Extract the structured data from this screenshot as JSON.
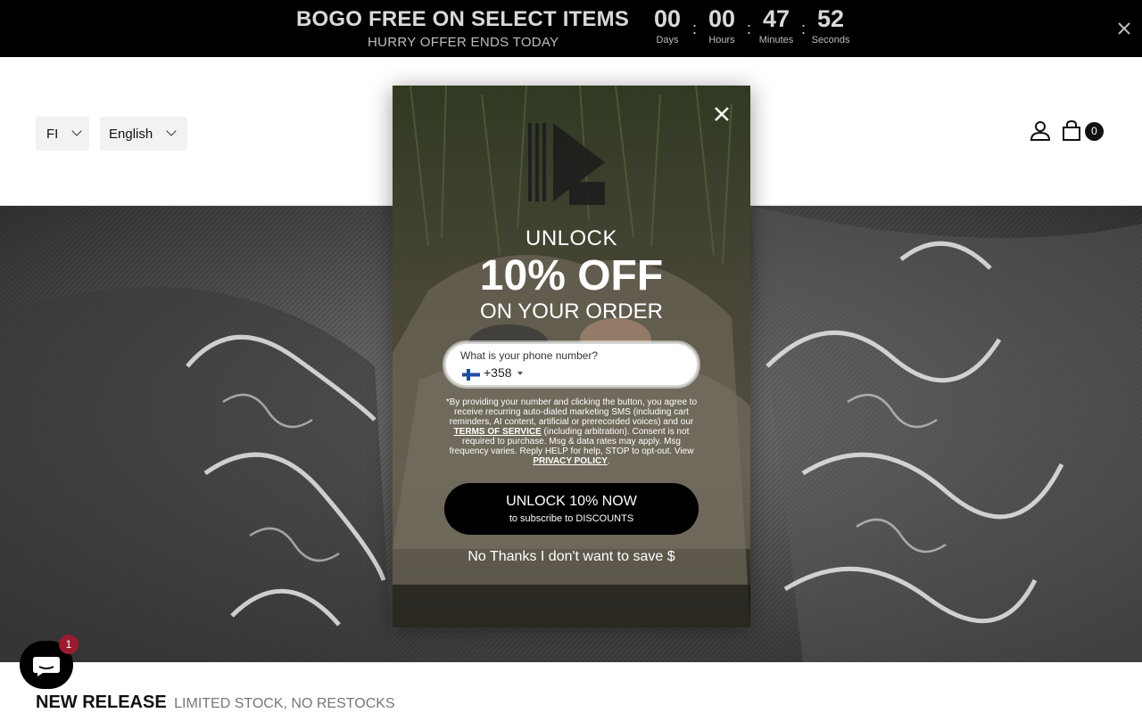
{
  "announcement": {
    "headline": "BOGO FREE ON SELECT ITEMS",
    "subline": "HURRY OFFER ENDS TODAY",
    "countdown": [
      {
        "value": "00",
        "label": "Days"
      },
      {
        "value": "00",
        "label": "Hours"
      },
      {
        "value": "47",
        "label": "Minutes"
      },
      {
        "value": "52",
        "label": "Seconds"
      }
    ],
    "separator": ":",
    "close_icon": "close-icon"
  },
  "header": {
    "country": "FI",
    "language": "English",
    "cart_count": "0",
    "icons": [
      "account-icon",
      "cart-icon",
      "chevron-down-icon"
    ]
  },
  "section": {
    "title": "NEW RELEASE",
    "subtitle": "LIMITED STOCK, NO RESTOCKS"
  },
  "chat": {
    "badge": "1",
    "icon": "chat-icon"
  },
  "popup": {
    "line1": "UNLOCK",
    "line2": "10% OFF",
    "line3": "ON YOUR ORDER",
    "phone_label": "What is your phone number?",
    "phone_code": "+358",
    "legal_part1": "*By providing your number and clicking the button, you agree to receive recurring auto-dialed marketing SMS (including cart reminders, AI content, artificial or prerecorded voices) and our",
    "terms_link": "TERMS OF SERVICE",
    "legal_part2": "(including arbitration). Consent is not required to purchase. Msg & data rates may apply. Msg frequency varies. Reply HELP for help, STOP to opt-out. View",
    "privacy_link": "PRIVACY POLICY",
    "legal_end": ".",
    "cta_main": "UNLOCK 10% NOW",
    "cta_sub": "to subscribe to DISCOUNTS",
    "decline": "No Thanks I don't want to save $",
    "colors": {
      "cta": "#000000",
      "text": "#ffffff"
    }
  }
}
